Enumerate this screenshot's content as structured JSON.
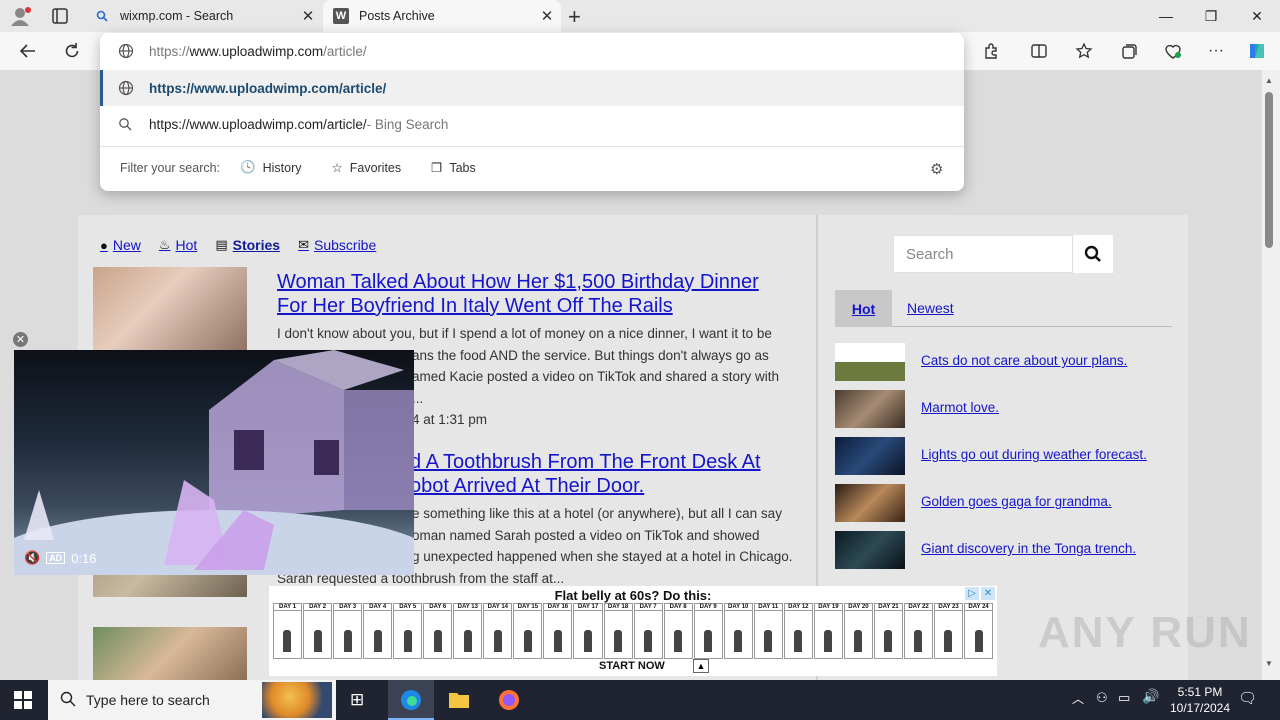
{
  "browser": {
    "tabs": [
      {
        "title": "wixmp.com - Search",
        "icon": "search-icon"
      },
      {
        "title": "Posts Archive",
        "icon": "w-icon"
      }
    ],
    "address": "https://www.uploadwimp.com/article/",
    "address_prefix": "https://",
    "address_domain": "www.uploadwimp.com",
    "address_path": "/article/"
  },
  "omnibox": {
    "suggestion_url": "https://www.uploadwimp.com/article/",
    "search_query": "https://www.uploadwimp.com/article/",
    "search_suffix": " - Bing Search",
    "filter_label": "Filter your search:",
    "filters": [
      "History",
      "Favorites",
      "Tabs"
    ]
  },
  "site_nav": {
    "new": "New",
    "hot": "Hot",
    "stories": "Stories",
    "subscribe": "Subscribe"
  },
  "articles": [
    {
      "title_line1": "Woman Talked About How Her $1,500 Birthday Dinner",
      "title_line2": "For Her Boyfriend In Italy Went Off The Rails",
      "body_line1": "I don't know about you, but if I spend a lot of money on a nice dinner, I want it to be",
      "body_line2": "ans the food AND the service. But things don't always go as",
      "body_line3": "amed Kacie posted a video on TikTok and shared a story with",
      "body_line4": "...",
      "date": "4 at 1:31 pm"
    },
    {
      "title_line1": "d A Toothbrush From The Front Desk At",
      "title_line2": "obot Arrived At Their Door.",
      "body_line1": "e something like this at a hotel (or anywhere), but all I can say",
      "body_line2": "oman named Sarah posted a video on TikTok and showed",
      "body_line3": "g unexpected happened when she stayed at a hotel in Chicago.",
      "body_line4": "Sarah requested a toothbrush from the staff at..."
    }
  ],
  "sidebar": {
    "search_placeholder": "Search",
    "tab_hot": "Hot",
    "tab_newest": "Newest",
    "items": [
      {
        "label": "Cats do not care about your plans."
      },
      {
        "label": "Marmot love."
      },
      {
        "label": "Lights go out during weather forecast."
      },
      {
        "label": "Golden goes gaga for grandma."
      },
      {
        "label": "Giant discovery in the Tonga trench."
      }
    ]
  },
  "video": {
    "time": "0:16",
    "ad_badge": "AD"
  },
  "ad": {
    "headline": "Flat belly at 60s? Do this:",
    "cta": "START NOW",
    "days": [
      "DAY 1",
      "DAY 2",
      "DAY 3",
      "DAY 4",
      "DAY 5",
      "DAY 6",
      "DAY 13",
      "DAY 14",
      "DAY 15",
      "DAY 16",
      "DAY 17",
      "DAY 18",
      "DAY 7",
      "DAY 8",
      "DAY 9",
      "DAY 10",
      "DAY 11",
      "DAY 12",
      "DAY 19",
      "DAY 20",
      "DAY 21",
      "DAY 22",
      "DAY 23",
      "DAY 24"
    ]
  },
  "taskbar": {
    "search_placeholder": "Type here to search",
    "time": "5:51 PM",
    "date": "10/17/2024"
  },
  "watermark": "ANY RUN"
}
